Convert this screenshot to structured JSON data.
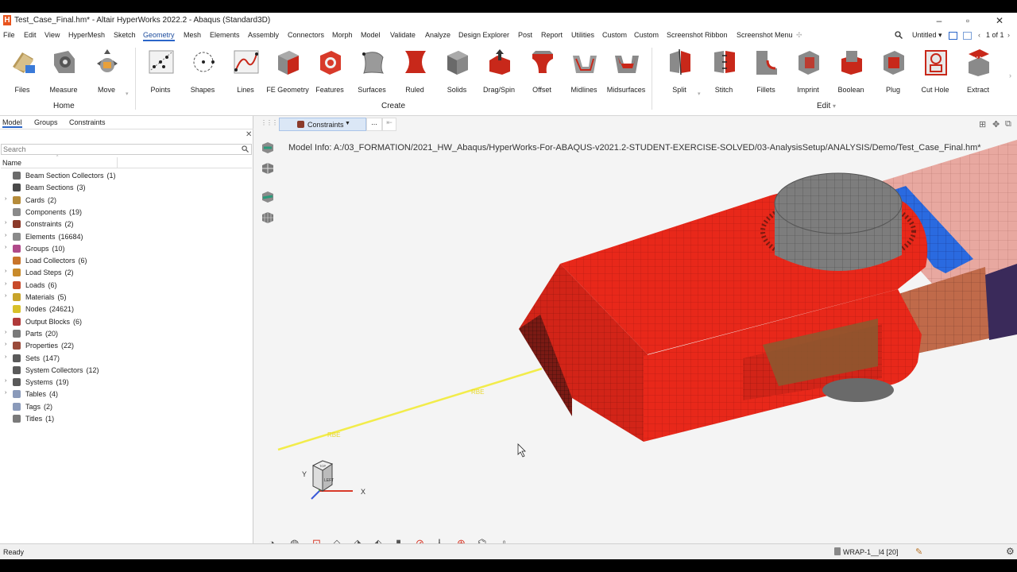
{
  "window": {
    "title": "Test_Case_Final.hm* - Altair HyperWorks 2022.2 - Abaqus (Standard3D)",
    "logo": "H"
  },
  "menubar": {
    "items": [
      "File",
      "Edit",
      "View",
      "HyperMesh",
      "Sketch",
      "Geometry",
      "Mesh",
      "Elements",
      "Assembly",
      "Connectors",
      "Morph",
      "Model",
      "Validate",
      "Analyze",
      "Design Explorer",
      "Post",
      "Report",
      "Utilities",
      "Custom",
      "Custom",
      "Screenshot Ribbon",
      "Screenshot Menu"
    ],
    "active": "Geometry",
    "untitled_label": "Untitled",
    "page_counter": "1 of 1"
  },
  "ribbon": {
    "home_tools": [
      "Files",
      "Measure",
      "Move"
    ],
    "create_tools": [
      "Points",
      "Shapes",
      "Lines",
      "FE Geometry",
      "Features",
      "Surfaces",
      "Ruled",
      "Solids",
      "Drag/Spin",
      "Offset",
      "Midlines",
      "Midsurfaces"
    ],
    "edit_tools": [
      "Split",
      "Stitch",
      "Fillets",
      "Imprint",
      "Boolean",
      "Plug",
      "Cut Hole",
      "Extract"
    ],
    "group_home": "Home",
    "group_create": "Create",
    "group_edit": "Edit"
  },
  "panel": {
    "tabs": [
      "Model",
      "Groups",
      "Constraints"
    ],
    "search_placeholder": "Search",
    "column_name": "Name",
    "tree": [
      {
        "label": "Beam Section Collectors",
        "count": "(1)",
        "expandable": false,
        "color": "#6b6b6b"
      },
      {
        "label": "Beam Sections",
        "count": "(3)",
        "expandable": false,
        "color": "#4a4a4a"
      },
      {
        "label": "Cards",
        "count": "(2)",
        "expandable": true,
        "color": "#b58b3a"
      },
      {
        "label": "Components",
        "count": "(19)",
        "expandable": false,
        "color": "#8a8a8a"
      },
      {
        "label": "Constraints",
        "count": "(2)",
        "expandable": true,
        "color": "#8b3a2a"
      },
      {
        "label": "Elements",
        "count": "(16684)",
        "expandable": true,
        "color": "#8a8a8a"
      },
      {
        "label": "Groups",
        "count": "(10)",
        "expandable": true,
        "color": "#b04a8a"
      },
      {
        "label": "Load Collectors",
        "count": "(6)",
        "expandable": false,
        "color": "#c8742a"
      },
      {
        "label": "Load Steps",
        "count": "(2)",
        "expandable": true,
        "color": "#c88a2a"
      },
      {
        "label": "Loads",
        "count": "(6)",
        "expandable": true,
        "color": "#c84a2a"
      },
      {
        "label": "Materials",
        "count": "(5)",
        "expandable": true,
        "color": "#c8a42a"
      },
      {
        "label": "Nodes",
        "count": "(24621)",
        "expandable": false,
        "color": "#d8c02a"
      },
      {
        "label": "Output Blocks",
        "count": "(6)",
        "expandable": false,
        "color": "#b03a3a"
      },
      {
        "label": "Parts",
        "count": "(20)",
        "expandable": true,
        "color": "#7a7a7a"
      },
      {
        "label": "Properties",
        "count": "(22)",
        "expandable": true,
        "color": "#9a4a3a"
      },
      {
        "label": "Sets",
        "count": "(147)",
        "expandable": true,
        "color": "#5a5a5a"
      },
      {
        "label": "System Collectors",
        "count": "(12)",
        "expandable": false,
        "color": "#5a5a5a"
      },
      {
        "label": "Systems",
        "count": "(19)",
        "expandable": true,
        "color": "#5a5a5a"
      },
      {
        "label": "Tables",
        "count": "(4)",
        "expandable": true,
        "color": "#8a9aba"
      },
      {
        "label": "Tags",
        "count": "(2)",
        "expandable": false,
        "color": "#8a9aba"
      },
      {
        "label": "Titles",
        "count": "(1)",
        "expandable": false,
        "color": "#7a7a7a"
      }
    ]
  },
  "viewport": {
    "tab_label": "Constraints",
    "tab_menu": "...",
    "model_info": "Model Info: A:/03_FORMATION/2021_HW_Abaqus/HyperWorks-For-ABAQUS-v2021.2-STUDENT-EXERCISE-SOLVED/03-AnalysisSetup/ANALYSIS/Demo/Test_Case_Final.hm*",
    "axis_x": "X",
    "axis_y": "Y",
    "cube_face": "LEFT",
    "cube_top": "TOP"
  },
  "status": {
    "text": "Ready",
    "component": "WRAP-1__l4 [20]"
  },
  "colors": {
    "accent": "#2b66c9",
    "mesh_red": "#e8281a",
    "mesh_gray": "#7d7d7d",
    "mesh_pink": "#e8a8a0",
    "mesh_blue": "#2a6ae0",
    "beam_yellow": "#f2ec4a"
  }
}
